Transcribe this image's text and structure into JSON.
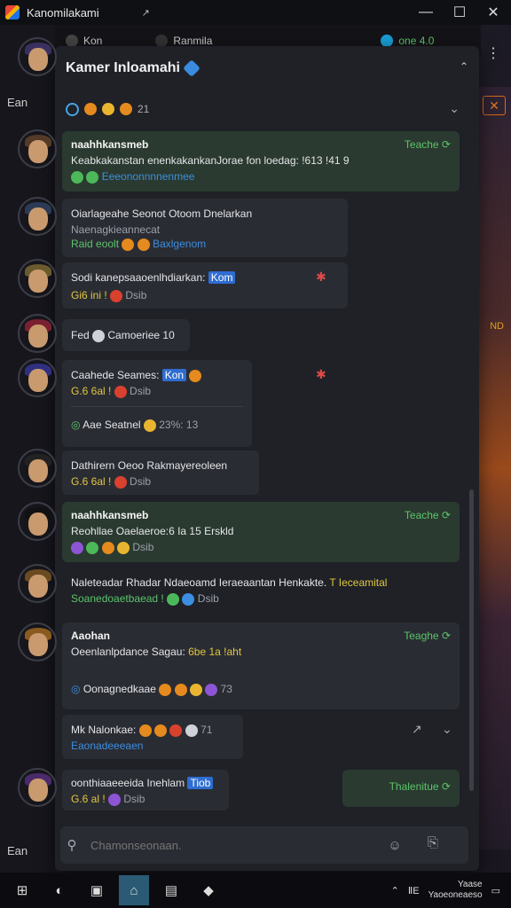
{
  "window": {
    "title": "Kanomilakami",
    "pin_glyph": "↗",
    "minimize": "—",
    "maximize": "☐",
    "close": "✕"
  },
  "background_app": {
    "tabs": [
      {
        "label": "Kon"
      },
      {
        "label": "Ranmila"
      },
      {
        "label": "one 4.0"
      }
    ],
    "left_items": [
      "Ean",
      "Ean"
    ],
    "right_label": "ND",
    "menu_glyph": "⋮"
  },
  "panel": {
    "title": "Kamer Inloamahi",
    "collapse_glyph": "⌃",
    "subbar": {
      "count": "21",
      "chevron": "⌄"
    }
  },
  "messages": [
    {
      "author": "naahhkansmeb",
      "text": "Keabkakanstan enenkakankanJorae fon loedag: !613 !41 9",
      "meta": "Eeeononnnnenmee",
      "reply": "Teache ⟳"
    },
    {
      "author": "Oiarlageahe",
      "text": "Oiarlageahe  Seonot  Otoom  Dnelarkan",
      "meta": "Naenagkieannecat",
      "meta2": "Baxlgenom",
      "sub": "Raid eoolt"
    },
    {
      "author": "Sodi",
      "text": "Sodi kanepsaaoenlhdiarkan:",
      "tag": "Kom",
      "meta": "Gi6 ini !",
      "meta2": "Dsib"
    },
    {
      "author": "Fed",
      "text": "Fed",
      "extra": "Camoeriee 10"
    },
    {
      "author": "Caahede",
      "text": "Caahede Seames:",
      "tag": "Kon",
      "meta": "G.6 6al !",
      "meta2": "Dsib",
      "sub_text": "Aae Seatnel",
      "sub_count": "23%: 13"
    },
    {
      "author": "Dathirern",
      "text": "Dathirern Oeoo  Rakmayereoleen",
      "meta": "G.6 6al !",
      "meta2": "Dsib"
    },
    {
      "author": "naahhkansmeb",
      "text": "Reohllae Oaelaeroe:6 Ia 15 Erskld",
      "meta2": "Dsib",
      "reply": "Teache ⟳"
    },
    {
      "author": "Naleteadar",
      "text": "Naleteadar  Rhadar Ndaeoamd Ieraeaantan Henkakte.",
      "tail": "T Ieceamital",
      "meta": "Soanedoaetbaead !",
      "meta2": "Dsib"
    },
    {
      "author": "Aaohan",
      "text": "Oeenlanlpdance Sagau:",
      "tail": "6be 1a !aht",
      "sub_text": "Oonagnedkaae",
      "sub_count": "73",
      "reply": "Teaghe ⟳"
    },
    {
      "author": "Mk",
      "text": "Mk Nalonkae:",
      "meta": "Eaonadeeeaen",
      "count": "71"
    },
    {
      "author": "oonthiaaeeeida",
      "text": "oonthiaaeeeida Inehlam",
      "tag": "Tiob",
      "meta": "G.6 al !",
      "meta2": "Dsib",
      "reply": "Thalenitue ⟳"
    }
  ],
  "composer": {
    "placeholder": "Chamonseonaan.",
    "emoji_glyph": "☺",
    "attach_glyph": "⎘",
    "search_glyph": "⚲"
  },
  "taskbar": {
    "start_glyph": "⊞",
    "clock_time": "Yaase",
    "clock_date": "Yaoeoneaeso",
    "tray_label": "ⅡE"
  },
  "colors": {
    "accent": "#3b8ee0",
    "reply": "#5cc46a",
    "panel": "#1f2127",
    "bubble": "#2a2c33"
  }
}
